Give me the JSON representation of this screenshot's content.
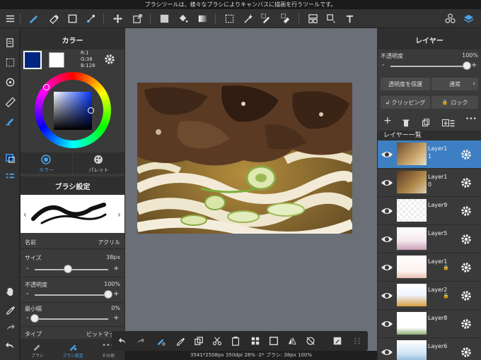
{
  "top_hint": "ブラシツールは、様々なブラシによりキャンバスに描画を行うツールです。",
  "color_panel": {
    "title": "カラー",
    "rgb": {
      "r": "R:1",
      "g": "G:38",
      "b": "B:128"
    },
    "primary_color": "#012680",
    "tab_color": "カラー",
    "tab_palette": "パレット"
  },
  "brush_panel": {
    "title": "ブラシ設定",
    "name_label": "名前",
    "name_value": "アクリル",
    "size_label": "サイズ",
    "size_value": "38px",
    "size_fraction": 0.45,
    "opacity_label": "不透明度",
    "opacity_value": "100%",
    "opacity_fraction": 1.0,
    "minwidth_label": "最小幅",
    "minwidth_value": "0%",
    "minwidth_fraction": 0.0,
    "type_label": "タイプ",
    "type_value": "ビットマップ",
    "bottom_tabs": [
      "ブラシ",
      "ブラシ設定",
      "その他"
    ]
  },
  "layer_panel": {
    "title": "レイヤー",
    "opacity_label": "不透明度",
    "opacity_value": "100%",
    "opacity_fraction": 1.0,
    "protect_label": "透明度を保護",
    "blend_label": "通常",
    "clipping_label": "クリッピング",
    "lock_label": "ロック",
    "list_header": "レイヤー一覧",
    "layers": [
      {
        "name": "Layer11",
        "selected": true,
        "locked": false
      },
      {
        "name": "Layer10",
        "selected": false,
        "locked": false
      },
      {
        "name": "Layer9",
        "selected": false,
        "locked": false
      },
      {
        "name": "Layer5",
        "selected": false,
        "locked": false
      },
      {
        "name": "Layer1",
        "selected": false,
        "locked": true
      },
      {
        "name": "Layer2",
        "selected": false,
        "locked": true
      },
      {
        "name": "Layer8",
        "selected": false,
        "locked": false
      },
      {
        "name": "Layer6",
        "selected": false,
        "locked": false
      }
    ]
  },
  "status": "3541*2508px 350dpi 28% -2* ブラシ: 38px 100%",
  "colors": {
    "accent": "#3d7fc2",
    "panel": "#3a3a3a",
    "canvas_bg": "#6b6f78"
  }
}
